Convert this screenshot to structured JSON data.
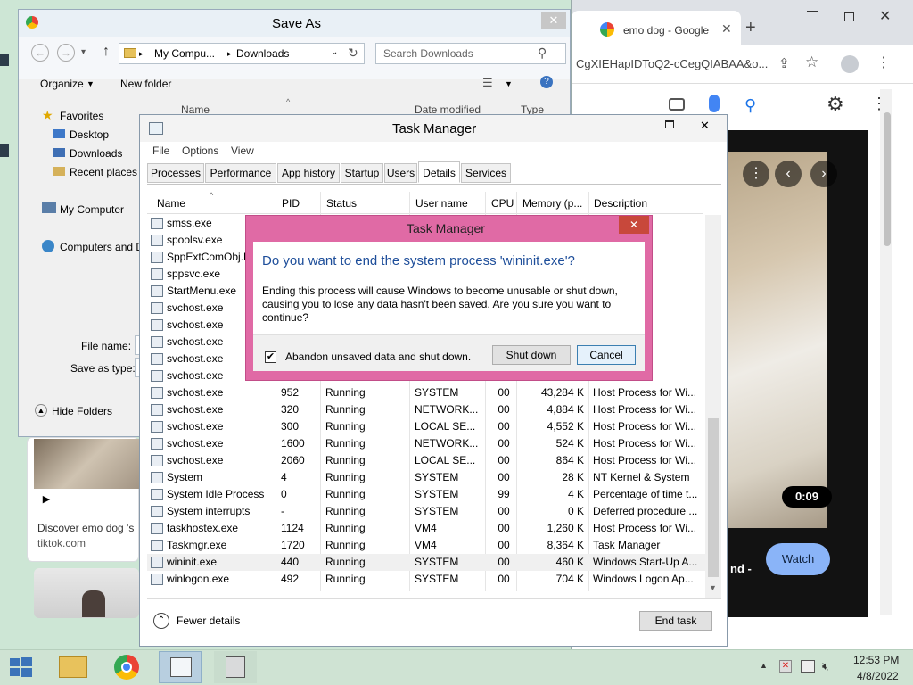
{
  "chrome": {
    "tab_title": "emo dog - Google",
    "address": "CgXIEHapIDToQ2-cCegQIABAA&o...",
    "video_time": "0:09",
    "watch_label": "Watch",
    "partial_text": "nd -",
    "result_title": "Discover emo dog 's",
    "result_source": "tiktok.com"
  },
  "saveas": {
    "title": "Save As",
    "breadcrumb": [
      "My Compu...",
      "Downloads"
    ],
    "search_placeholder": "Search Downloads",
    "organize_label": "Organize",
    "new_folder_label": "New folder",
    "columns": [
      "Name",
      "Date modified",
      "Type"
    ],
    "tree": {
      "favorites": "Favorites",
      "items": [
        "Desktop",
        "Downloads",
        "Recent places"
      ],
      "computer": "My Computer",
      "network": "Computers and D"
    },
    "file_name_label": "File name:",
    "save_as_type_label": "Save as type:",
    "hide_folders_label": "Hide Folders"
  },
  "taskmanager": {
    "title": "Task Manager",
    "menu": [
      "File",
      "Options",
      "View"
    ],
    "tabs": [
      "Processes",
      "Performance",
      "App history",
      "Startup",
      "Users",
      "Details",
      "Services"
    ],
    "columns": [
      "Name",
      "PID",
      "Status",
      "User name",
      "CPU",
      "Memory (p...",
      "Description"
    ],
    "rows": [
      {
        "name": "smss.exe",
        "pid": "",
        "status": "",
        "user": "",
        "cpu": "",
        "mem": "",
        "desc": "ssion M..."
      },
      {
        "name": "spoolsv.exe",
        "pid": "",
        "status": "",
        "user": "",
        "cpu": "",
        "mem": "",
        "desc": "System ..."
      },
      {
        "name": "SppExtComObj.E",
        "pid": "",
        "status": "",
        "user": "",
        "cpu": "",
        "mem": "",
        "desc": "ction Br..."
      },
      {
        "name": "sppsvc.exe",
        "pid": "",
        "status": "",
        "user": "",
        "cpu": "",
        "mem": "",
        "desc": "ftware ..."
      },
      {
        "name": "StartMenu.exe",
        "pid": "",
        "status": "",
        "user": "",
        "cpu": "",
        "mem": "",
        "desc": "Menu"
      },
      {
        "name": "svchost.exe",
        "pid": "",
        "status": "",
        "user": "",
        "cpu": "",
        "mem": "",
        "desc": "s for Wi..."
      },
      {
        "name": "svchost.exe",
        "pid": "",
        "status": "",
        "user": "",
        "cpu": "",
        "mem": "",
        "desc": "s for Wi..."
      },
      {
        "name": "svchost.exe",
        "pid": "",
        "status": "",
        "user": "",
        "cpu": "",
        "mem": "",
        "desc": "s for Wi..."
      },
      {
        "name": "svchost.exe",
        "pid": "",
        "status": "",
        "user": "",
        "cpu": "",
        "mem": "",
        "desc": "s for Wi..."
      },
      {
        "name": "svchost.exe",
        "pid": "",
        "status": "",
        "user": "",
        "cpu": "",
        "mem": "",
        "desc": "s for Wi..."
      },
      {
        "name": "svchost.exe",
        "pid": "952",
        "status": "Running",
        "user": "SYSTEM",
        "cpu": "00",
        "mem": "43,284 K",
        "desc": "Host Process for Wi..."
      },
      {
        "name": "svchost.exe",
        "pid": "320",
        "status": "Running",
        "user": "NETWORK...",
        "cpu": "00",
        "mem": "4,884 K",
        "desc": "Host Process for Wi..."
      },
      {
        "name": "svchost.exe",
        "pid": "300",
        "status": "Running",
        "user": "LOCAL SE...",
        "cpu": "00",
        "mem": "4,552 K",
        "desc": "Host Process for Wi..."
      },
      {
        "name": "svchost.exe",
        "pid": "1600",
        "status": "Running",
        "user": "NETWORK...",
        "cpu": "00",
        "mem": "524 K",
        "desc": "Host Process for Wi..."
      },
      {
        "name": "svchost.exe",
        "pid": "2060",
        "status": "Running",
        "user": "LOCAL SE...",
        "cpu": "00",
        "mem": "864 K",
        "desc": "Host Process for Wi..."
      },
      {
        "name": "System",
        "pid": "4",
        "status": "Running",
        "user": "SYSTEM",
        "cpu": "00",
        "mem": "28 K",
        "desc": "NT Kernel & System"
      },
      {
        "name": "System Idle Process",
        "pid": "0",
        "status": "Running",
        "user": "SYSTEM",
        "cpu": "99",
        "mem": "4 K",
        "desc": "Percentage of time t..."
      },
      {
        "name": "System interrupts",
        "pid": "-",
        "status": "Running",
        "user": "SYSTEM",
        "cpu": "00",
        "mem": "0 K",
        "desc": "Deferred procedure ..."
      },
      {
        "name": "taskhostex.exe",
        "pid": "1124",
        "status": "Running",
        "user": "VM4",
        "cpu": "00",
        "mem": "1,260 K",
        "desc": "Host Process for Wi..."
      },
      {
        "name": "Taskmgr.exe",
        "pid": "1720",
        "status": "Running",
        "user": "VM4",
        "cpu": "00",
        "mem": "8,364 K",
        "desc": "Task Manager"
      },
      {
        "name": "wininit.exe",
        "pid": "440",
        "status": "Running",
        "user": "SYSTEM",
        "cpu": "00",
        "mem": "460 K",
        "desc": "Windows Start-Up A..."
      },
      {
        "name": "winlogon.exe",
        "pid": "492",
        "status": "Running",
        "user": "SYSTEM",
        "cpu": "00",
        "mem": "704 K",
        "desc": "Windows Logon Ap..."
      }
    ],
    "fewer_details_label": "Fewer details",
    "end_task_label": "End task"
  },
  "dialog": {
    "title": "Task Manager",
    "heading": "Do you want to end the system process 'wininit.exe'?",
    "body": "Ending this process will cause Windows to become unusable or shut down, causing you to lose any data hasn't been saved. Are you sure you want to continue?",
    "checkbox_label": "Abandon unsaved data and shut down.",
    "checkbox_checked": true,
    "shutdown_label": "Shut down",
    "cancel_label": "Cancel"
  },
  "taskbar": {
    "time": "12:53 PM",
    "date": "4/8/2022"
  }
}
